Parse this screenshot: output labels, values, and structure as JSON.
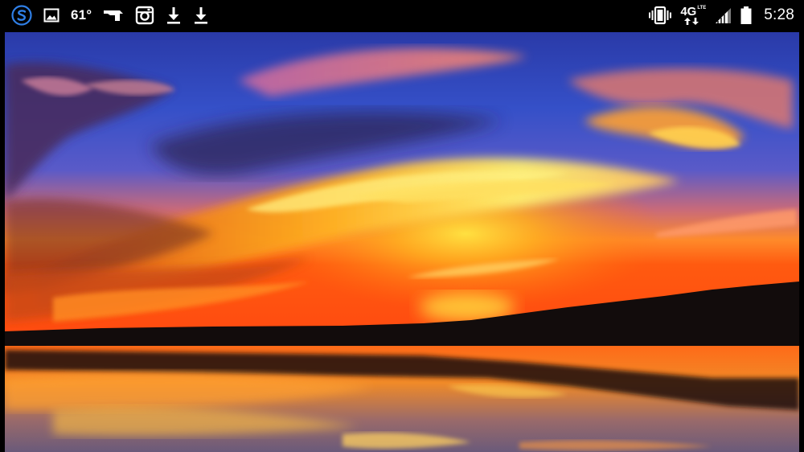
{
  "status_bar": {
    "temperature": "61°",
    "network_type": "4G",
    "network_sub": "LTE",
    "clock": "5:28"
  },
  "status_icons": [
    "swiftkey-s-icon",
    "gallery-image-icon",
    "weather-temperature",
    "sign-arrow-icon",
    "instagram-icon",
    "download-icon",
    "download-icon",
    "vibrate-icon",
    "4g-lte-icon",
    "signal-strength-icon",
    "battery-icon"
  ],
  "colors": {
    "status_bar_bg": "#000000",
    "swiftkey_accent": "#2f7fe6",
    "sky_top": "#2f3fb0",
    "sky_horizon": "#ff7a10",
    "sun_glow": "#ffd23a",
    "treeline": "#120c0c",
    "water": "#e8761a"
  },
  "photo": {
    "subject": "sunset-over-lake"
  }
}
